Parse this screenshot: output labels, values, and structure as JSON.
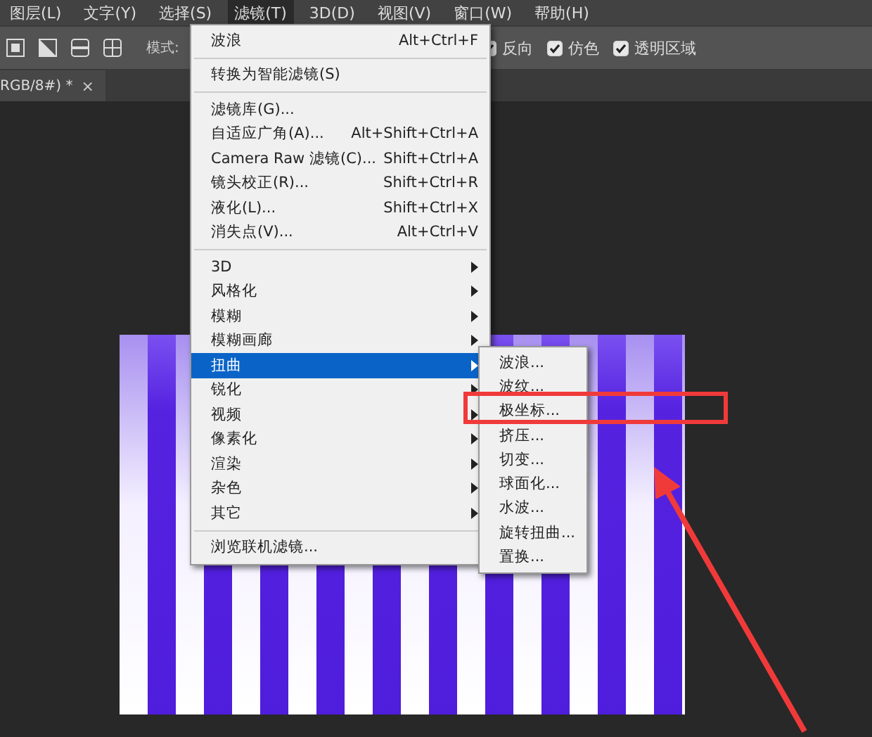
{
  "menu_bar": [
    {
      "label": "图层(L)",
      "selected": false
    },
    {
      "label": "文字(Y)",
      "selected": false
    },
    {
      "label": "选择(S)",
      "selected": false
    },
    {
      "label": "滤镜(T)",
      "selected": true
    },
    {
      "label": "3D(D)",
      "selected": false
    },
    {
      "label": "视图(V)",
      "selected": false
    },
    {
      "label": "窗口(W)",
      "selected": false
    },
    {
      "label": "帮助(H)",
      "selected": false
    }
  ],
  "options_bar": {
    "mode_label": "模式:",
    "checkboxes": [
      {
        "label": "反向",
        "checked": true
      },
      {
        "label": "仿色",
        "checked": true
      },
      {
        "label": "透明区域",
        "checked": true
      }
    ]
  },
  "document_tab": {
    "title": "RGB/8#) *",
    "close": "×"
  },
  "filter_menu": [
    {
      "kind": "item",
      "label": "波浪",
      "shortcut": "Alt+Ctrl+F"
    },
    {
      "kind": "separator"
    },
    {
      "kind": "item",
      "label": "转换为智能滤镜(S)"
    },
    {
      "kind": "separator"
    },
    {
      "kind": "item",
      "label": "滤镜库(G)..."
    },
    {
      "kind": "item",
      "label": "自适应广角(A)...",
      "shortcut": "Alt+Shift+Ctrl+A"
    },
    {
      "kind": "item",
      "label": "Camera Raw 滤镜(C)...",
      "shortcut": "Shift+Ctrl+A"
    },
    {
      "kind": "item",
      "label": "镜头校正(R)...",
      "shortcut": "Shift+Ctrl+R"
    },
    {
      "kind": "item",
      "label": "液化(L)...",
      "shortcut": "Shift+Ctrl+X"
    },
    {
      "kind": "item",
      "label": "消失点(V)...",
      "shortcut": "Alt+Ctrl+V"
    },
    {
      "kind": "separator"
    },
    {
      "kind": "submenu",
      "label": "3D",
      "selected": false
    },
    {
      "kind": "submenu",
      "label": "风格化",
      "selected": false
    },
    {
      "kind": "submenu",
      "label": "模糊",
      "selected": false
    },
    {
      "kind": "submenu",
      "label": "模糊画廊",
      "selected": false
    },
    {
      "kind": "submenu",
      "label": "扭曲",
      "selected": true
    },
    {
      "kind": "submenu",
      "label": "锐化",
      "selected": false
    },
    {
      "kind": "submenu",
      "label": "视频",
      "selected": false
    },
    {
      "kind": "submenu",
      "label": "像素化",
      "selected": false
    },
    {
      "kind": "submenu",
      "label": "渲染",
      "selected": false
    },
    {
      "kind": "submenu",
      "label": "杂色",
      "selected": false
    },
    {
      "kind": "submenu",
      "label": "其它",
      "selected": false
    },
    {
      "kind": "separator"
    },
    {
      "kind": "item",
      "label": "浏览联机滤镜..."
    }
  ],
  "distort_submenu": [
    "波浪...",
    "波纹...",
    "极坐标...",
    "挤压...",
    "切变...",
    "球面化...",
    "水波...",
    "旋转扭曲...",
    "置换..."
  ]
}
